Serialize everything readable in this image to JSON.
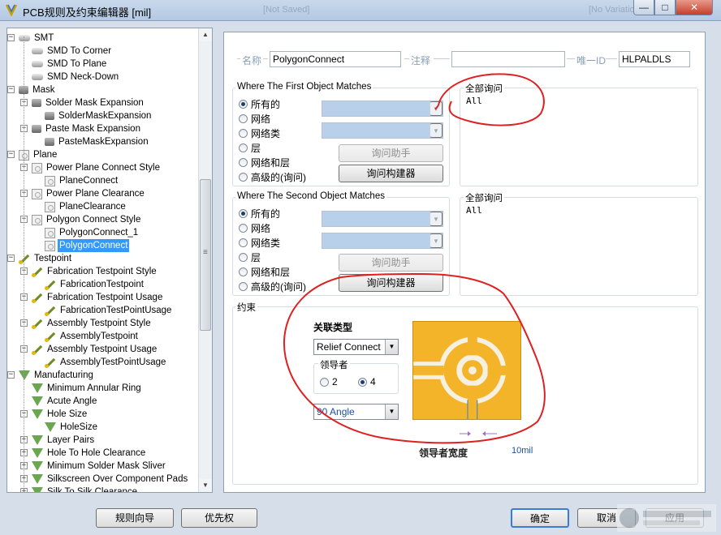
{
  "window": {
    "title": "PCB规则及约束编辑器 [mil]",
    "ghost_left": "[Not Saved]",
    "ghost_right": "[No Variations]",
    "min": "—",
    "max": "□",
    "close": "✕"
  },
  "tree": {
    "items": [
      {
        "label": "SMT",
        "icon": "smt-icon",
        "expander": "−",
        "level": 1
      },
      {
        "label": "SMD To Corner",
        "icon": "smt-icon",
        "level": 2
      },
      {
        "label": "SMD To Plane",
        "icon": "smt-icon",
        "level": 2
      },
      {
        "label": "SMD Neck-Down",
        "icon": "smt-icon",
        "level": 2
      },
      {
        "label": "Mask",
        "icon": "mask-icon",
        "expander": "−",
        "level": 1
      },
      {
        "label": "Solder Mask Expansion",
        "icon": "mask-icon",
        "expander": "−",
        "level": 2
      },
      {
        "label": "SolderMaskExpansion",
        "icon": "mask-icon",
        "level": 3
      },
      {
        "label": "Paste Mask Expansion",
        "icon": "mask-icon",
        "expander": "−",
        "level": 2
      },
      {
        "label": "PasteMaskExpansion",
        "icon": "mask-icon",
        "level": 3
      },
      {
        "label": "Plane",
        "icon": "plane-icon",
        "expander": "−",
        "level": 1
      },
      {
        "label": "Power Plane Connect Style",
        "icon": "plane-icon",
        "expander": "−",
        "level": 2
      },
      {
        "label": "PlaneConnect",
        "icon": "plane-icon",
        "level": 3
      },
      {
        "label": "Power Plane Clearance",
        "icon": "plane-icon",
        "expander": "−",
        "level": 2
      },
      {
        "label": "PlaneClearance",
        "icon": "plane-icon",
        "level": 3
      },
      {
        "label": "Polygon Connect Style",
        "icon": "plane-icon",
        "expander": "−",
        "level": 2
      },
      {
        "label": "PolygonConnect_1",
        "icon": "plane-icon",
        "level": 3
      },
      {
        "label": "PolygonConnect",
        "icon": "plane-icon",
        "level": 3,
        "selected": true
      },
      {
        "label": "Testpoint",
        "icon": "testpoint-icon",
        "expander": "−",
        "level": 1
      },
      {
        "label": "Fabrication Testpoint Style",
        "icon": "testpoint-icon",
        "expander": "−",
        "level": 2
      },
      {
        "label": "FabricationTestpoint",
        "icon": "testpoint-icon",
        "level": 3
      },
      {
        "label": "Fabrication Testpoint Usage",
        "icon": "testpoint-icon",
        "expander": "−",
        "level": 2
      },
      {
        "label": "FabricationTestPointUsage",
        "icon": "testpoint-icon",
        "level": 3
      },
      {
        "label": "Assembly Testpoint Style",
        "icon": "testpoint-icon",
        "expander": "−",
        "level": 2
      },
      {
        "label": "AssemblyTestpoint",
        "icon": "testpoint-icon",
        "level": 3
      },
      {
        "label": "Assembly Testpoint Usage",
        "icon": "testpoint-icon",
        "expander": "−",
        "level": 2
      },
      {
        "label": "AssemblyTestPointUsage",
        "icon": "testpoint-icon",
        "level": 3
      },
      {
        "label": "Manufacturing",
        "icon": "manufacturing-icon",
        "expander": "−",
        "level": 1
      },
      {
        "label": "Minimum Annular Ring",
        "icon": "manufacturing-icon",
        "level": 2
      },
      {
        "label": "Acute Angle",
        "icon": "manufacturing-icon",
        "level": 2
      },
      {
        "label": "Hole Size",
        "icon": "manufacturing-icon",
        "expander": "−",
        "level": 2
      },
      {
        "label": "HoleSize",
        "icon": "manufacturing-icon",
        "level": 3
      },
      {
        "label": "Layer Pairs",
        "icon": "manufacturing-icon",
        "expander": "+",
        "level": 2
      },
      {
        "label": "Hole To Hole Clearance",
        "icon": "manufacturing-icon",
        "expander": "+",
        "level": 2
      },
      {
        "label": "Minimum Solder Mask Sliver",
        "icon": "manufacturing-icon",
        "expander": "+",
        "level": 2
      },
      {
        "label": "Silkscreen Over Component Pads",
        "icon": "manufacturing-icon",
        "expander": "+",
        "level": 2
      },
      {
        "label": "Silk To Silk Clearance",
        "icon": "manufacturing-icon",
        "expander": "+",
        "level": 2
      }
    ]
  },
  "rule": {
    "name_label": "名称",
    "name_value": "PolygonConnect",
    "comment_label": "注释",
    "comment_value": "",
    "uid_label": "唯一ID",
    "uid_value": "HLPALDLS"
  },
  "first_match": {
    "title": "Where The First Object Matches",
    "options": [
      "所有的",
      "网络",
      "网络类",
      "层",
      "网络和层",
      "高级的(询问)"
    ],
    "selected_index": 0,
    "query_helper": "询问助手",
    "query_builder": "询问构建器",
    "query_title": "全部询问",
    "query_text": "All"
  },
  "second_match": {
    "title": "Where The Second Object Matches",
    "options": [
      "所有的",
      "网络",
      "网络类",
      "层",
      "网络和层",
      "高级的(询问)"
    ],
    "selected_index": 0,
    "query_helper": "询问助手",
    "query_builder": "询问构建器",
    "query_title": "全部询问",
    "query_text": "All"
  },
  "constraints": {
    "title": "约束",
    "connect_type_label": "关联类型",
    "connect_type_value": "Relief Connect",
    "conductors_label": "领导者",
    "conductor_options": [
      "2",
      "4"
    ],
    "conductor_selected": "4",
    "angle_value": "90 Angle",
    "width_label": "领导者宽度",
    "width_value": "10mil"
  },
  "footer": {
    "rule_wizard": "规则向导",
    "priorities": "优先权",
    "ok": "确定",
    "cancel": "取消",
    "apply": "应用"
  },
  "colors": {
    "pad": "#f3b42a",
    "annotation": "#e02020",
    "selection": "#3399ff"
  }
}
